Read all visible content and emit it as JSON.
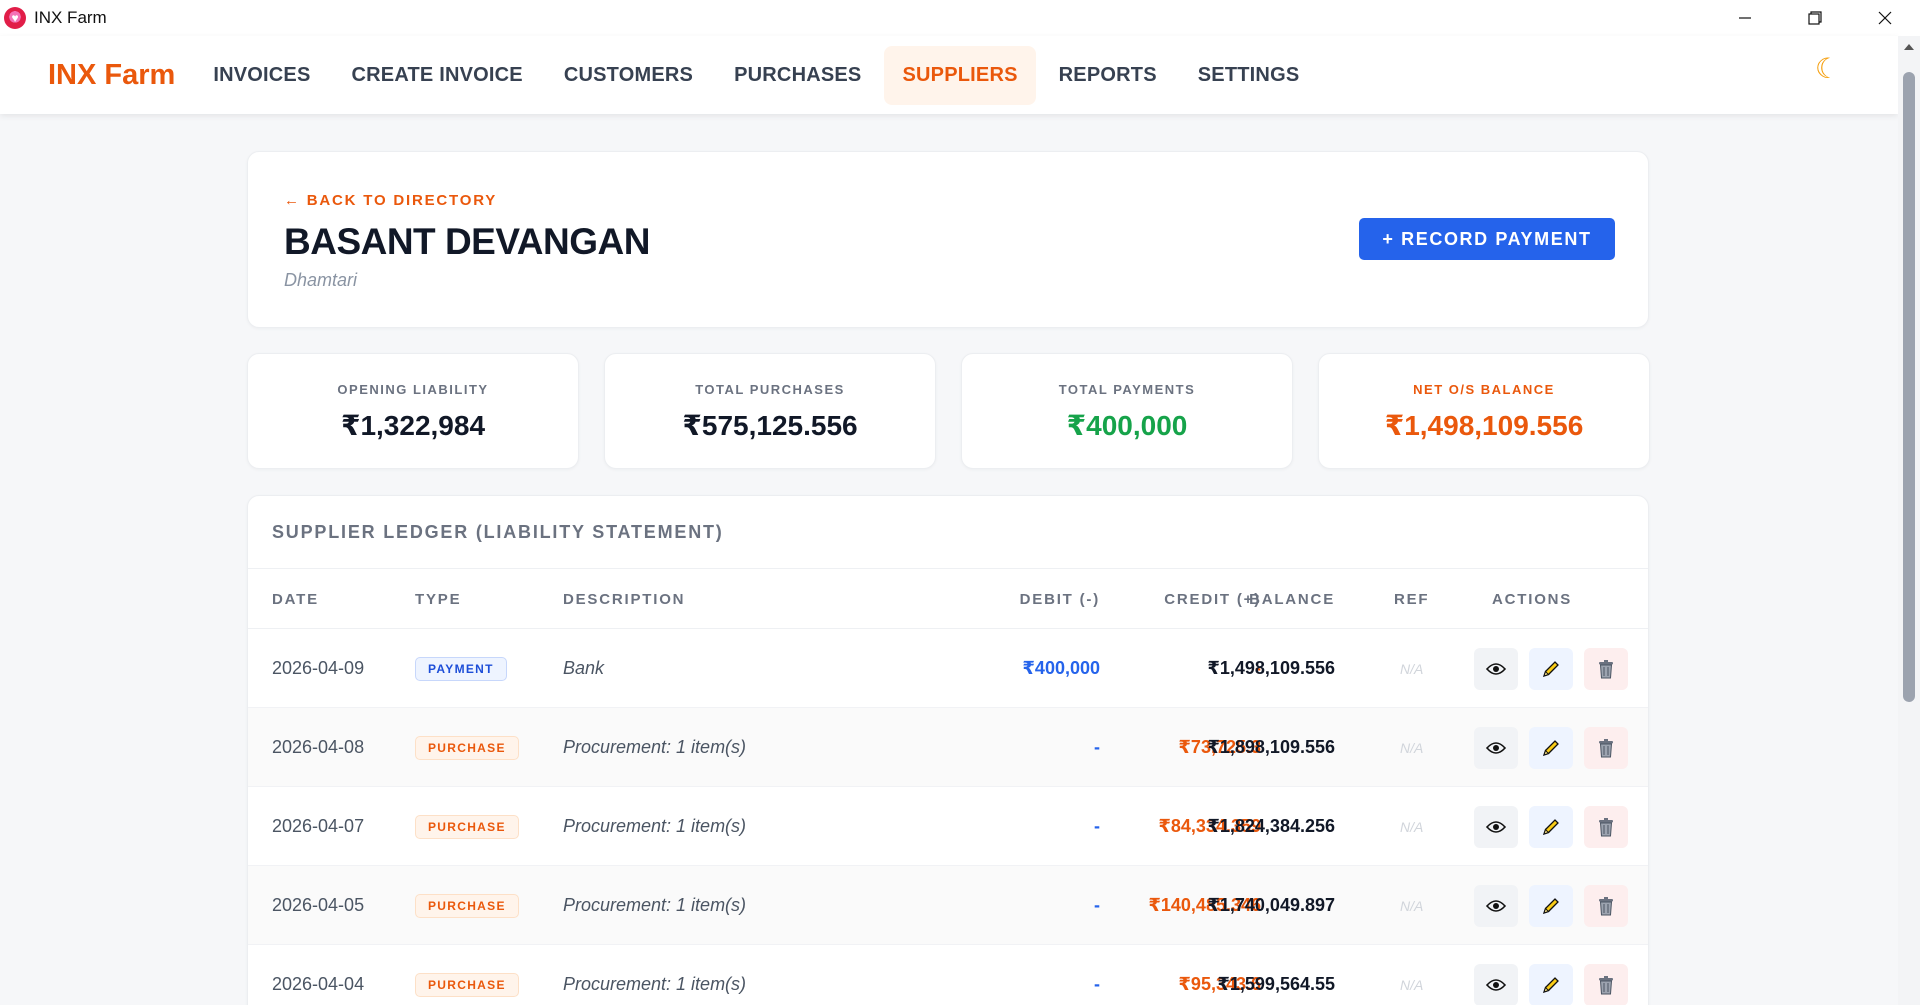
{
  "window": {
    "title": "INX Farm"
  },
  "nav": {
    "brand": "INX Farm",
    "items": [
      "INVOICES",
      "CREATE INVOICE",
      "CUSTOMERS",
      "PURCHASES",
      "SUPPLIERS",
      "REPORTS",
      "SETTINGS"
    ],
    "active": "SUPPLIERS"
  },
  "header": {
    "back_label": "← BACK TO DIRECTORY",
    "supplier_name": "BASANT DEVANGAN",
    "location": "Dhamtari",
    "record_button": "+ RECORD PAYMENT"
  },
  "stats": [
    {
      "label": "OPENING LIABILITY",
      "value": "₹1,322,984"
    },
    {
      "label": "TOTAL PURCHASES",
      "value": "₹575,125.556"
    },
    {
      "label": "TOTAL PAYMENTS",
      "value": "₹400,000"
    },
    {
      "label": "NET O/S BALANCE",
      "value": "₹1,498,109.556"
    }
  ],
  "ledger": {
    "title": "SUPPLIER LEDGER (LIABILITY STATEMENT)",
    "columns": [
      "DATE",
      "TYPE",
      "DESCRIPTION",
      "DEBIT (-)",
      "CREDIT (+)",
      "BALANCE",
      "REF",
      "ACTIONS"
    ],
    "rows": [
      {
        "date": "2026-04-09",
        "type": "PAYMENT",
        "desc": "Bank",
        "debit": "₹400,000",
        "credit": "-",
        "balance": "₹1,498,109.556",
        "ref": "N/A"
      },
      {
        "date": "2026-04-08",
        "type": "PURCHASE",
        "desc": "Procurement: 1 item(s)",
        "debit": "-",
        "credit": "₹73,725.3",
        "balance": "₹1,898,109.556",
        "ref": "N/A"
      },
      {
        "date": "2026-04-07",
        "type": "PURCHASE",
        "desc": "Procurement: 1 item(s)",
        "debit": "-",
        "credit": "₹84,334.359",
        "balance": "₹1,824,384.256",
        "ref": "N/A"
      },
      {
        "date": "2026-04-05",
        "type": "PURCHASE",
        "desc": "Procurement: 1 item(s)",
        "debit": "-",
        "credit": "₹140,485.346",
        "balance": "₹1,740,049.897",
        "ref": "N/A"
      },
      {
        "date": "2026-04-04",
        "type": "PURCHASE",
        "desc": "Procurement: 1 item(s)",
        "debit": "-",
        "credit": "₹95,343.6",
        "balance": "₹1,599,564.55",
        "ref": "N/A"
      }
    ]
  },
  "colors": {
    "accent": "#ea580c",
    "primary": "#2563eb",
    "success": "#16a34a"
  }
}
